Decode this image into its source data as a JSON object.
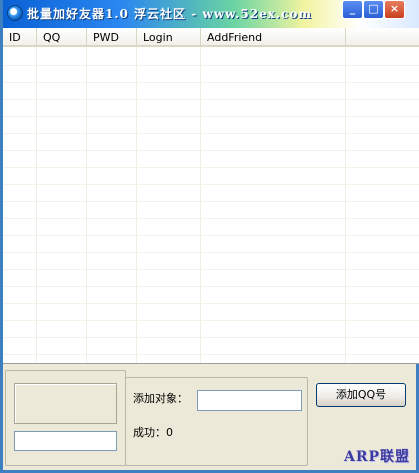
{
  "window": {
    "title": "批量加好友器1.0 浮云社区 - www.52ex.com",
    "controls": [
      "_",
      "□",
      "×"
    ]
  },
  "list": {
    "columns": [
      "ID",
      "QQ",
      "PWD",
      "Login",
      "AddFriend"
    ],
    "rows": []
  },
  "panel": {
    "target_label": "添加对象：",
    "target_value": "",
    "bottom_input_value": "",
    "success_label": "成功：",
    "success_count": "0",
    "add_button_label": "添加QQ号"
  },
  "watermark": "ARP联盟"
}
